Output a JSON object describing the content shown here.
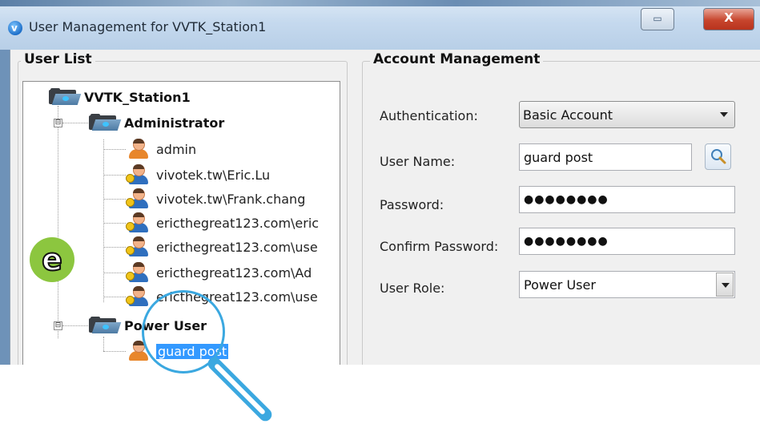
{
  "window": {
    "title": "User Management for VVTK_Station1",
    "restore_glyph": "▭",
    "close_glyph": "X"
  },
  "user_list": {
    "group_title": "User List",
    "root": "VVTK_Station1",
    "groups": [
      {
        "label": "Administrator",
        "expander": "⊟",
        "users": [
          "admin",
          "vivotek.tw\\Eric.Lu",
          "vivotek.tw\\Frank.chang",
          "ericthegreat123.com\\eric",
          "ericthegreat123.com\\use",
          "ericthegreat123.com\\Ad",
          "ericthegreat123.com\\use"
        ]
      },
      {
        "label": "Power User",
        "expander": "⊟",
        "users": [
          "guard post"
        ]
      }
    ],
    "selected_user": "guard post"
  },
  "account": {
    "group_title": "Account Management",
    "authentication_label": "Authentication:",
    "authentication_value": "Basic Account",
    "username_label": "User Name:",
    "username_value": "guard post",
    "password_label": "Password:",
    "password_value": "●●●●●●●●",
    "confirm_label": "Confirm Password:",
    "confirm_value": "●●●●●●●●",
    "role_label": "User Role:",
    "role_value": "Power User"
  },
  "overlay": {
    "badge_letter": "e"
  }
}
